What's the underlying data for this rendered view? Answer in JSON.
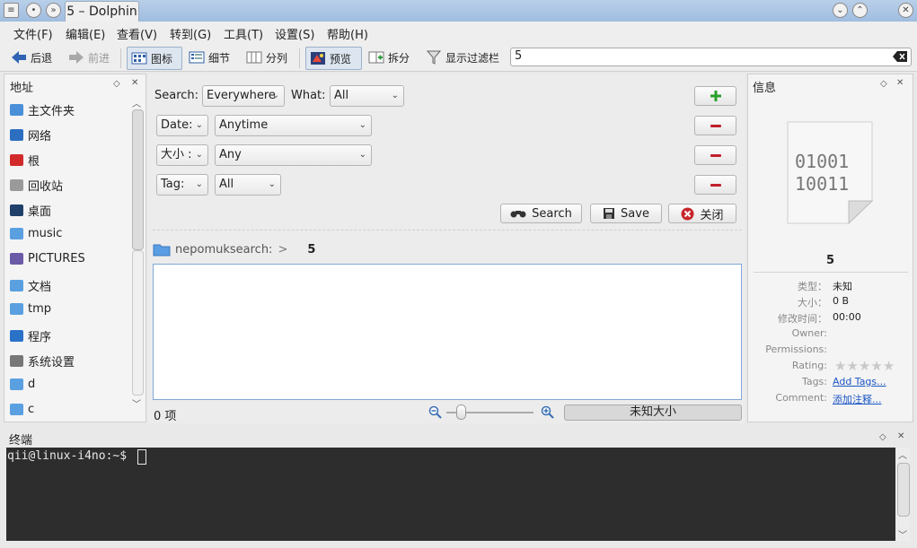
{
  "window": {
    "title": "5 – Dolphin"
  },
  "menu": [
    "文件(F)",
    "编辑(E)",
    "查看(V)",
    "转到(G)",
    "工具(T)",
    "设置(S)",
    "帮助(H)"
  ],
  "toolbar": {
    "back": "后退",
    "forward": "前进",
    "icons": "图标",
    "details": "细节",
    "columns": "分列",
    "preview": "预览",
    "split": "拆分",
    "filter_bar": "显示过滤栏",
    "filter_value": "5"
  },
  "places": {
    "title": "地址",
    "items": [
      {
        "label": "主文件夹",
        "icon": "home-icon"
      },
      {
        "label": "网络",
        "icon": "network-icon"
      },
      {
        "label": "根",
        "icon": "root-folder-icon"
      },
      {
        "label": "回收站",
        "icon": "trash-icon"
      },
      {
        "label": "桌面",
        "icon": "desktop-icon"
      },
      {
        "label": "music",
        "icon": "music-folder-icon"
      },
      {
        "label": "PICTURES",
        "icon": "pictures-folder-icon"
      },
      {
        "label": "文档",
        "icon": "documents-folder-icon"
      },
      {
        "label": "tmp",
        "icon": "folder-icon"
      },
      {
        "label": "程序",
        "icon": "kde-icon"
      },
      {
        "label": "系统设置",
        "icon": "settings-icon"
      },
      {
        "label": "d",
        "icon": "folder-icon"
      },
      {
        "label": "c",
        "icon": "folder-icon"
      }
    ]
  },
  "search": {
    "search_label": "Search:",
    "search_value": "Everywhere",
    "what_label": "What:",
    "what_value": "All",
    "date_label": "Date:",
    "date_value": "Anytime",
    "size_label": "大小 :",
    "size_value": "Any",
    "tag_label": "Tag:",
    "tag_value": "All",
    "search_button": "Search",
    "save_button": "Save",
    "close_button": "关闭"
  },
  "breadcrumb": {
    "root": "nepomuksearch:",
    "current": "5"
  },
  "status": {
    "count": "0 项",
    "free_space": "未知大小"
  },
  "info": {
    "title": "信息",
    "file_icon_text_1": "01001",
    "file_icon_text_2": "10011",
    "name": "5",
    "rows": [
      {
        "label": "类型：",
        "value": "未知"
      },
      {
        "label": "大小：",
        "value": "0 B"
      },
      {
        "label": "修改时间：",
        "value": "00:00"
      },
      {
        "label": "Owner:",
        "value": ""
      },
      {
        "label": "Permissions:",
        "value": ""
      },
      {
        "label": "Rating:",
        "value": ""
      },
      {
        "label": "Tags:",
        "value": "Add Tags..."
      },
      {
        "label": "Comment:",
        "value": "添加注释..."
      }
    ],
    "rating": 0
  },
  "terminal": {
    "title": "终端",
    "prompt": "qii@linux-i4no:~$ "
  },
  "colors": {
    "accent": "#3b7bd8",
    "link": "#1a55c4",
    "terminal_bg": "#2d2d2d"
  }
}
